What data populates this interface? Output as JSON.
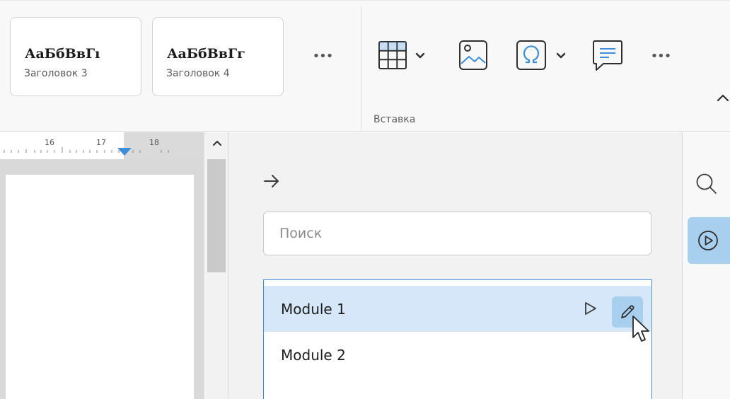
{
  "styles_gallery": {
    "items": [
      {
        "sample": "АаБбВвГı",
        "name": "Заголовок 3"
      },
      {
        "sample": "АаБбВвГг",
        "name": "Заголовок 4"
      }
    ],
    "more_label": "•••"
  },
  "insert_group": {
    "label": "Вставка",
    "more_label": "•••",
    "icons": [
      "table-icon",
      "image-icon",
      "special-character-icon",
      "comment-icon"
    ]
  },
  "ruler": {
    "ticks": [
      "16",
      "17",
      "18"
    ]
  },
  "macros_panel": {
    "search_placeholder": "Поиск",
    "items": [
      {
        "label": "Module 1",
        "selected": true
      },
      {
        "label": "Module 2",
        "selected": false
      }
    ]
  },
  "right_rail": {
    "icons": [
      "search-icon",
      "macros-icon"
    ]
  },
  "colors": {
    "accent": "#3c8fd6",
    "selection": "#d5e7f8",
    "active_button": "#a9cfee",
    "panel_bg": "#f2f2f2"
  }
}
